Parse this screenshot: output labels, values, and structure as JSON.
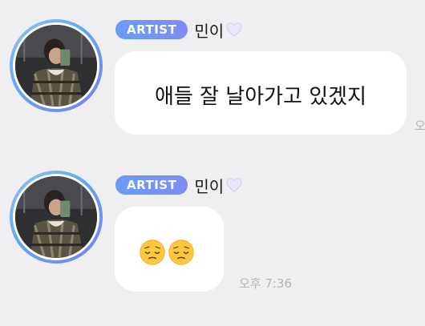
{
  "messages": [
    {
      "badge": "ARTIST",
      "sender": "민이",
      "text": "애들 잘 날아가고 있겠지",
      "time": "오후"
    },
    {
      "badge": "ARTIST",
      "sender": "민이",
      "emojis": [
        "pensive-face-icon",
        "pensive-face-icon"
      ],
      "time": "오후 7:36"
    }
  ],
  "colors": {
    "background": "#efeff1",
    "bubble": "#ffffff",
    "badge_start": "#6a9cf4",
    "badge_end": "#7f8cf2",
    "heart": "#e9e4f8",
    "timestamp": "#b6b6b6"
  }
}
